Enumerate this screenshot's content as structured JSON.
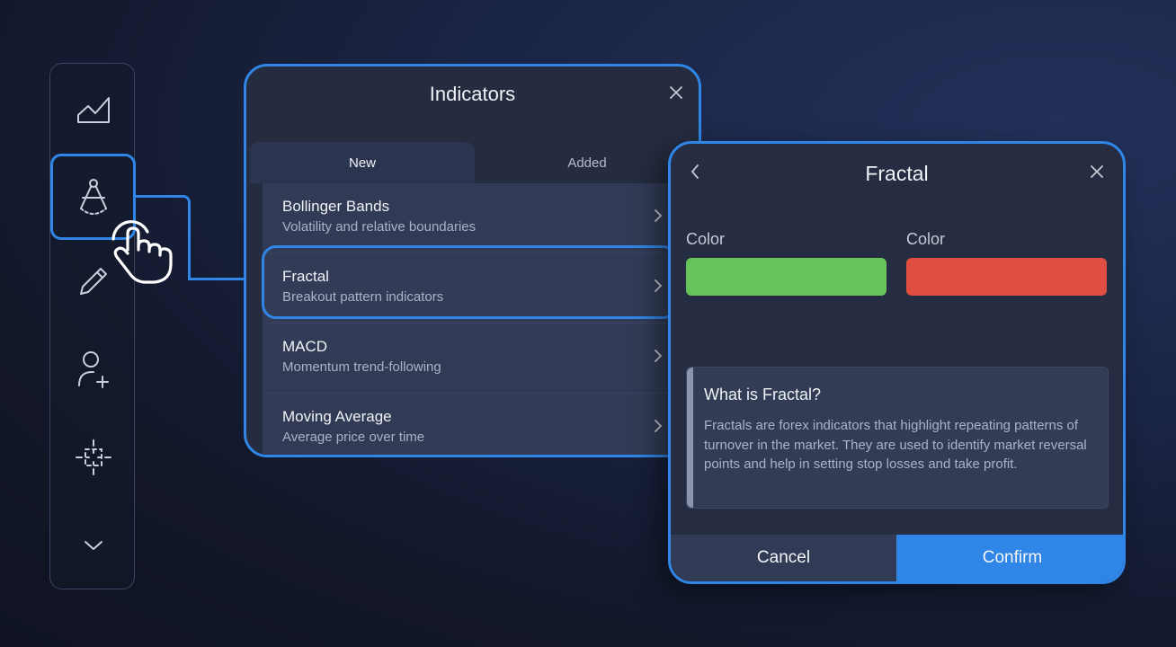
{
  "sidebar": {
    "icons": [
      "chart-area-icon",
      "compass-drawing-icon",
      "pencil-icon",
      "add-user-icon",
      "crosshair-grid-icon",
      "chevron-down-icon"
    ]
  },
  "indicators": {
    "title": "Indicators",
    "tabs": [
      {
        "label": "New",
        "active": true
      },
      {
        "label": "Added",
        "active": false
      }
    ],
    "items": [
      {
        "name": "Bollinger Bands",
        "desc": "Volatility and relative boundaries"
      },
      {
        "name": "Fractal",
        "desc": "Breakout pattern indicators"
      },
      {
        "name": "MACD",
        "desc": "Momentum trend-following"
      },
      {
        "name": "Moving Average",
        "desc": "Average price over time"
      }
    ]
  },
  "fractal": {
    "title": "Fractal",
    "color1_label": "Color",
    "color2_label": "Color",
    "color1": "#67c45a",
    "color2": "#e04e42",
    "info_title": "What is Fractal?",
    "info_text": "Fractals are forex indicators that highlight repeating patterns of turnover in the market. They are used to identify market reversal points and help in setting stop losses and take profit.",
    "cancel_label": "Cancel",
    "confirm_label": "Confirm"
  },
  "colors": {
    "accent": "#2f86e6"
  }
}
